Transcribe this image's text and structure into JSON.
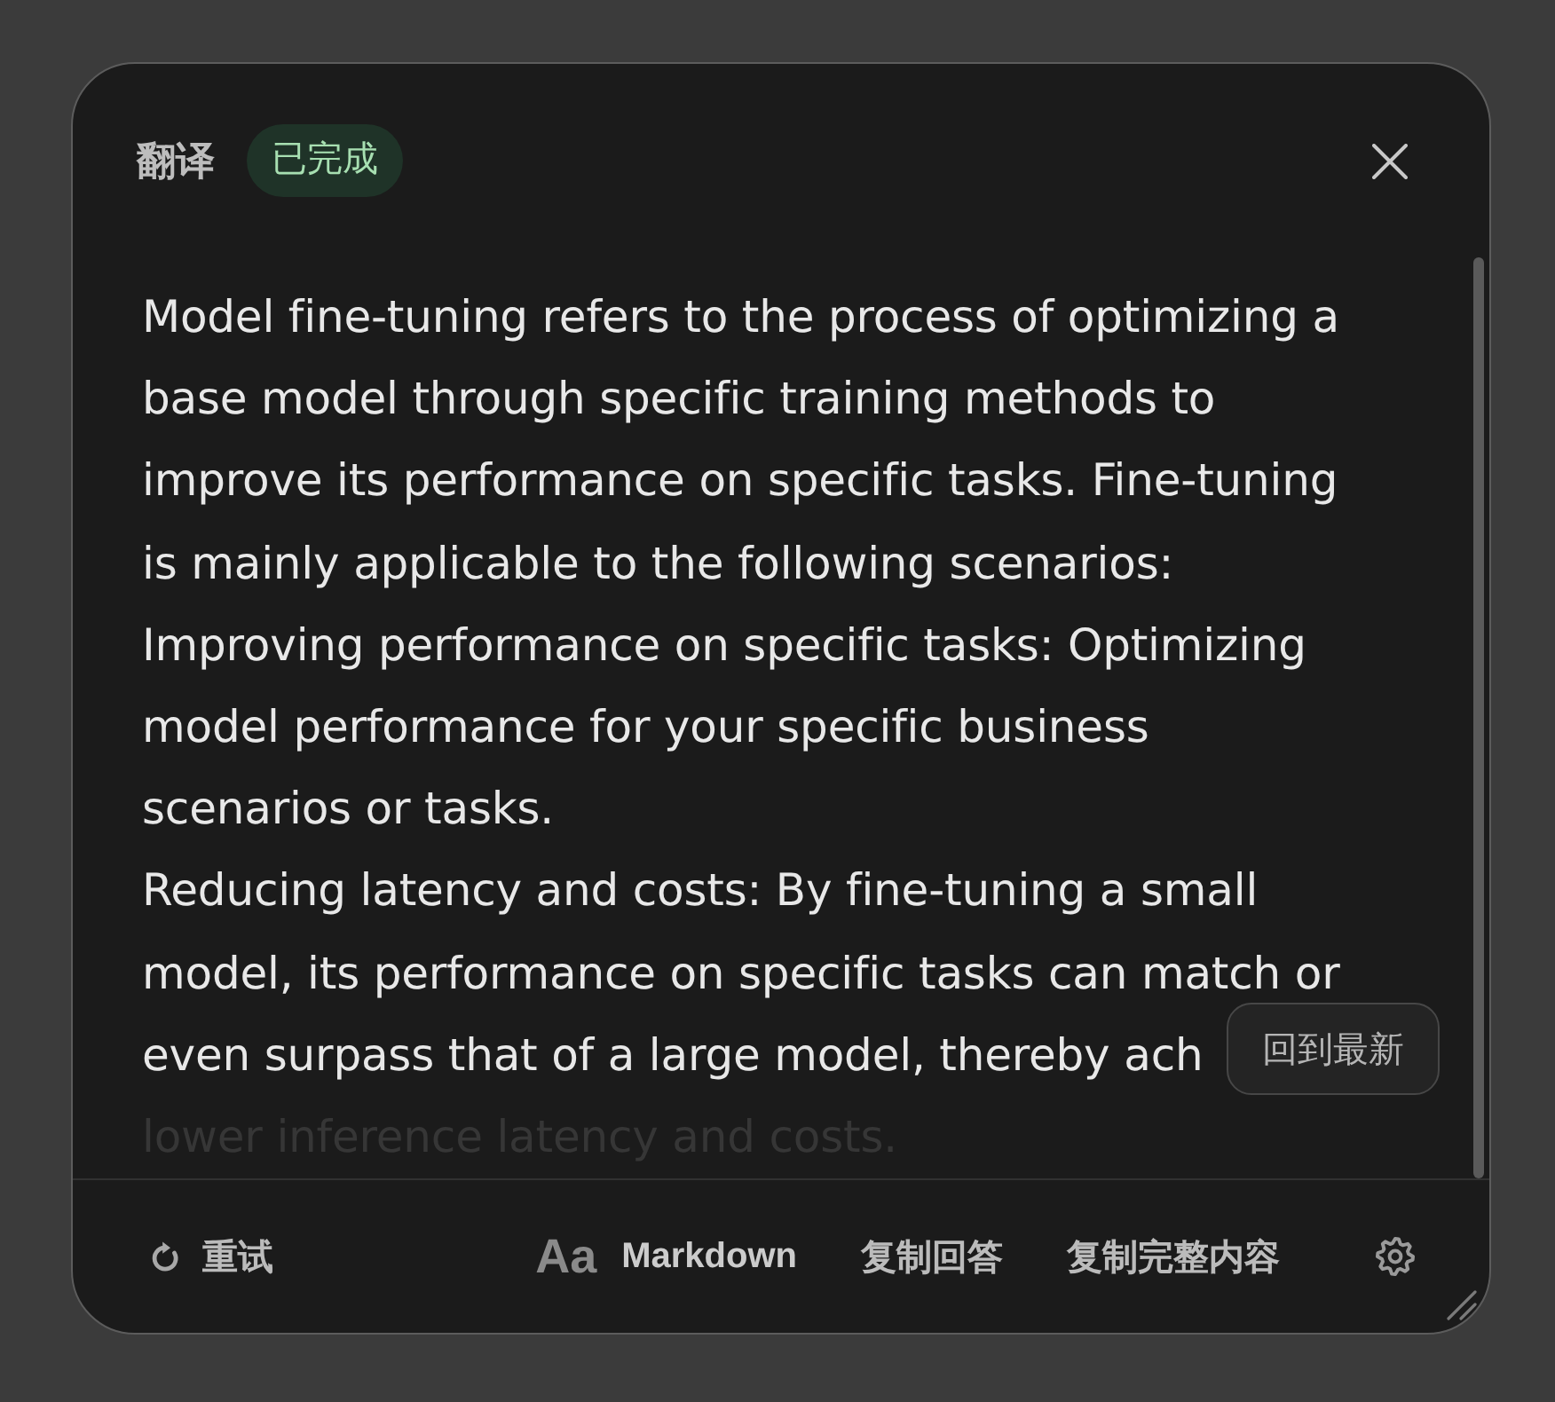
{
  "dialog": {
    "title": "翻译",
    "status": "已完成"
  },
  "content": {
    "lines": [
      {
        "text": "Model fine-tuning refers to the process of optimizing a",
        "kind": "normal"
      },
      {
        "text": "base model through specific training methods to",
        "kind": "normal"
      },
      {
        "text": "improve its performance on specific tasks. Fine-tuning",
        "kind": "normal"
      },
      {
        "text": "is mainly applicable to the following scenarios:",
        "kind": "normal"
      },
      {
        "text": "Improving performance on specific tasks: Optimizing",
        "kind": "normal"
      },
      {
        "text": "model performance for your specific business",
        "kind": "normal"
      },
      {
        "text": "scenarios or tasks.",
        "kind": "normal"
      },
      {
        "text": "Reducing latency and costs: By fine-tuning a small",
        "kind": "normal"
      },
      {
        "text": "model, its performance on specific tasks can match or",
        "kind": "normal"
      },
      {
        "text": "even surpass that of a large model, thereby ach",
        "kind": "normal"
      },
      {
        "text": "lower inference latency and costs.",
        "kind": "faded"
      }
    ],
    "jump_button": "回到最新"
  },
  "footer": {
    "retry": "重试",
    "format_icon": "Aa",
    "format": "Markdown",
    "actions": [
      "复制回答",
      "复制完整内容"
    ]
  }
}
